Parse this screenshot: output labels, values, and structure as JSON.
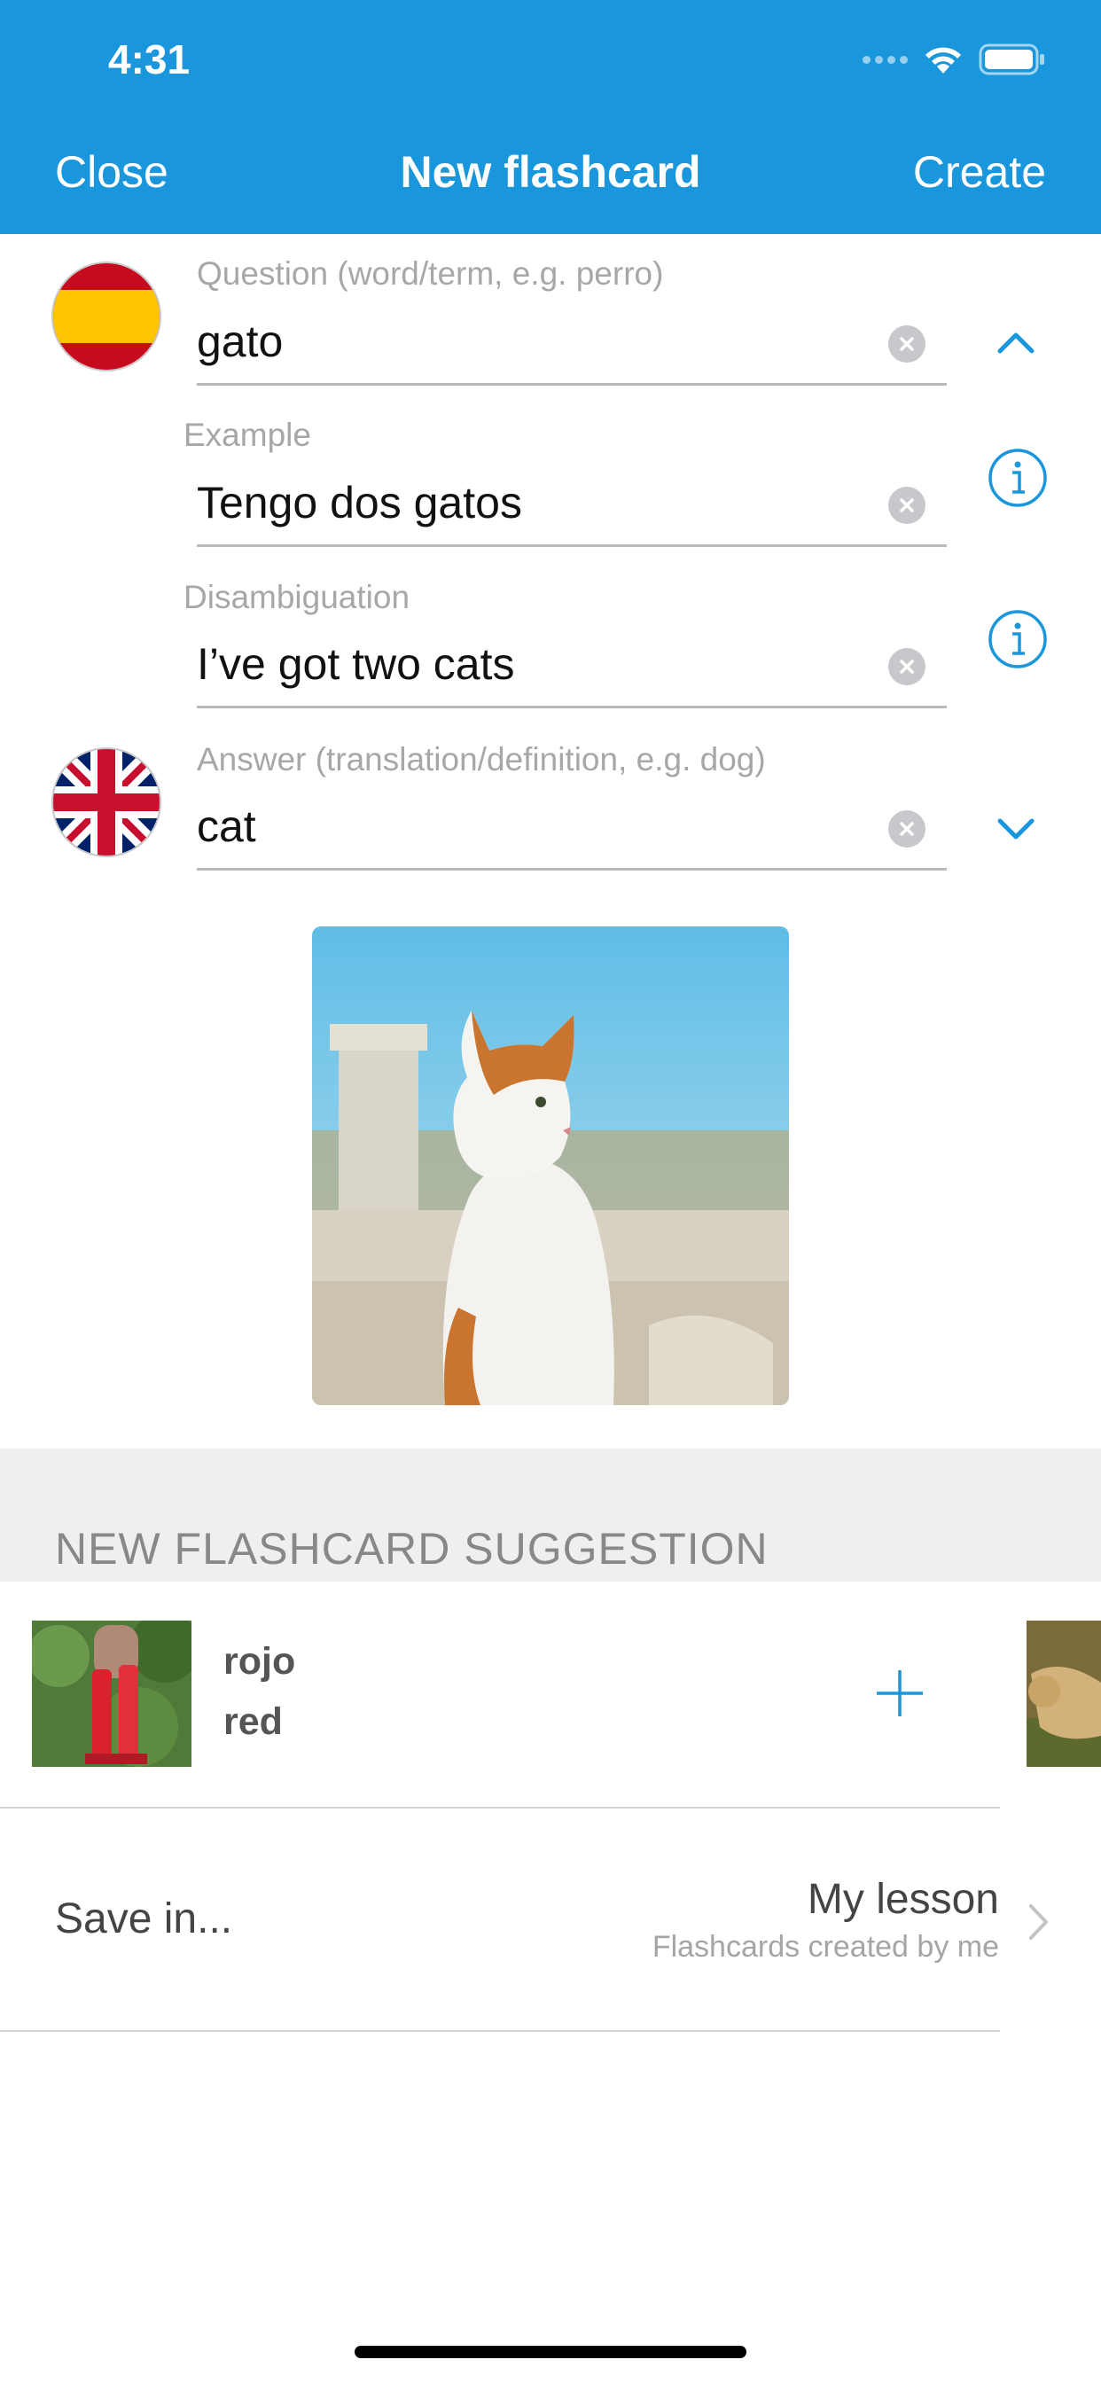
{
  "status_bar": {
    "time": "4:31"
  },
  "nav": {
    "close_label": "Close",
    "title": "New flashcard",
    "create_label": "Create"
  },
  "question": {
    "flag": "spain-flag",
    "label": "Question (word/term, e.g. perro)",
    "value": "gato",
    "toggle_icon": "chevron-up-icon"
  },
  "example": {
    "label": "Example",
    "value": "Tengo dos gatos",
    "info_icon": "info-icon"
  },
  "disambiguation": {
    "label": "Disambiguation",
    "value": "I’ve got two cats",
    "info_icon": "info-icon"
  },
  "answer": {
    "flag": "uk-flag",
    "label": "Answer (translation/definition, e.g. dog)",
    "value": "cat",
    "toggle_icon": "chevron-down-icon"
  },
  "image": {
    "subject": "cat-photo"
  },
  "suggestion": {
    "section_title": "NEW FLASHCARD SUGGESTION",
    "items": [
      {
        "word": "rojo",
        "translation": "red",
        "add_icon": "plus-icon"
      }
    ]
  },
  "save": {
    "label": "Save in...",
    "lesson": "My lesson",
    "lesson_sub": "Flashcards created by me"
  },
  "colors": {
    "primary": "#1a96dc",
    "accent": "#1a96dc",
    "section_bg": "#efefef"
  }
}
